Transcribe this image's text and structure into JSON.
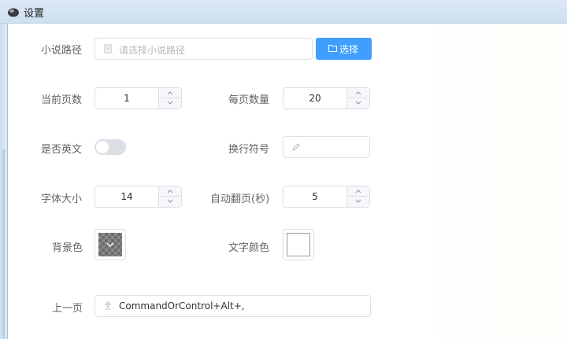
{
  "window": {
    "title": "设置"
  },
  "novel_path": {
    "label": "小说路径",
    "placeholder": "请选择小说路径",
    "button_label": "选择"
  },
  "current_page": {
    "label": "当前页数",
    "value": "1"
  },
  "per_page": {
    "label": "每页数量",
    "value": "20"
  },
  "is_english": {
    "label": "是否英文",
    "enabled": false
  },
  "line_break": {
    "label": "换行符号",
    "value": ""
  },
  "font_size": {
    "label": "字体大小",
    "value": "14"
  },
  "auto_flip": {
    "label": "自动翻页(秒)",
    "value": "5"
  },
  "background_color": {
    "label": "背景色"
  },
  "text_color": {
    "label": "文字颜色",
    "color": "#ffffff"
  },
  "prev_page": {
    "label": "上一页",
    "value": "CommandOrControl+Alt+,"
  },
  "icons": [
    "app-icon",
    "document-icon",
    "folder-icon",
    "edit-icon",
    "keyboard-icon",
    "chevron-up-icon",
    "chevron-down-icon"
  ],
  "colors": {
    "primary": "#409eff",
    "border": "#dcdfe6",
    "label": "#606266"
  }
}
